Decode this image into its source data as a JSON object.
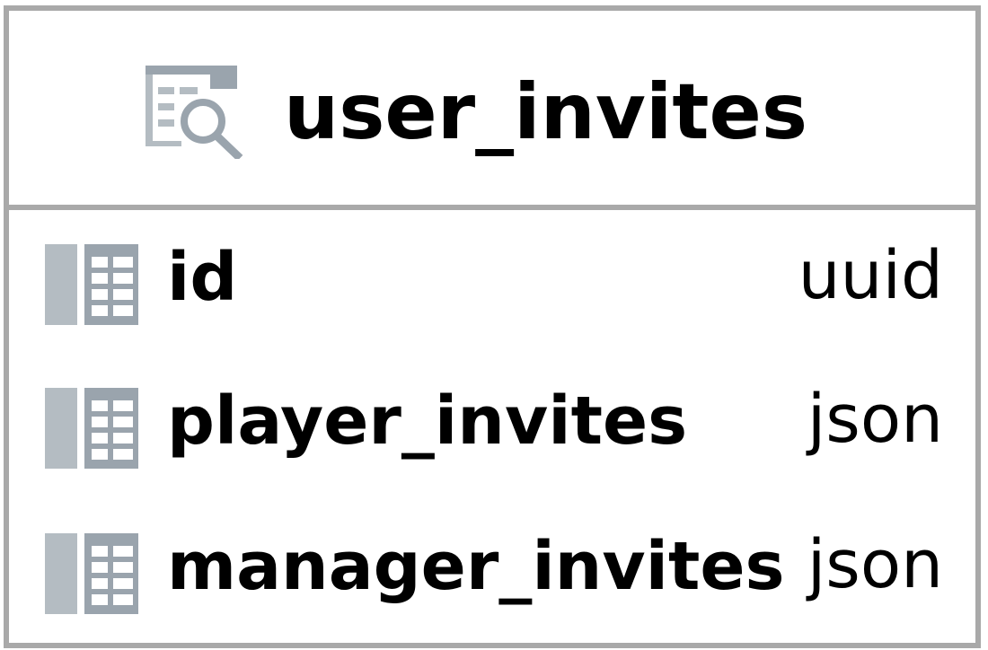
{
  "entity": {
    "name": "user_invites",
    "icon": "view-table-search-icon",
    "columns": [
      {
        "name": "id",
        "type": "uuid",
        "icon": "table-column-icon"
      },
      {
        "name": "player_invites",
        "type": "json",
        "icon": "table-column-icon"
      },
      {
        "name": "manager_invites",
        "type": "json",
        "icon": "table-column-icon"
      }
    ]
  },
  "colors": {
    "border": "#a9a9a9",
    "icon_dark": "#9aa4ad",
    "icon_light": "#b4bcc2",
    "text": "#000000"
  }
}
